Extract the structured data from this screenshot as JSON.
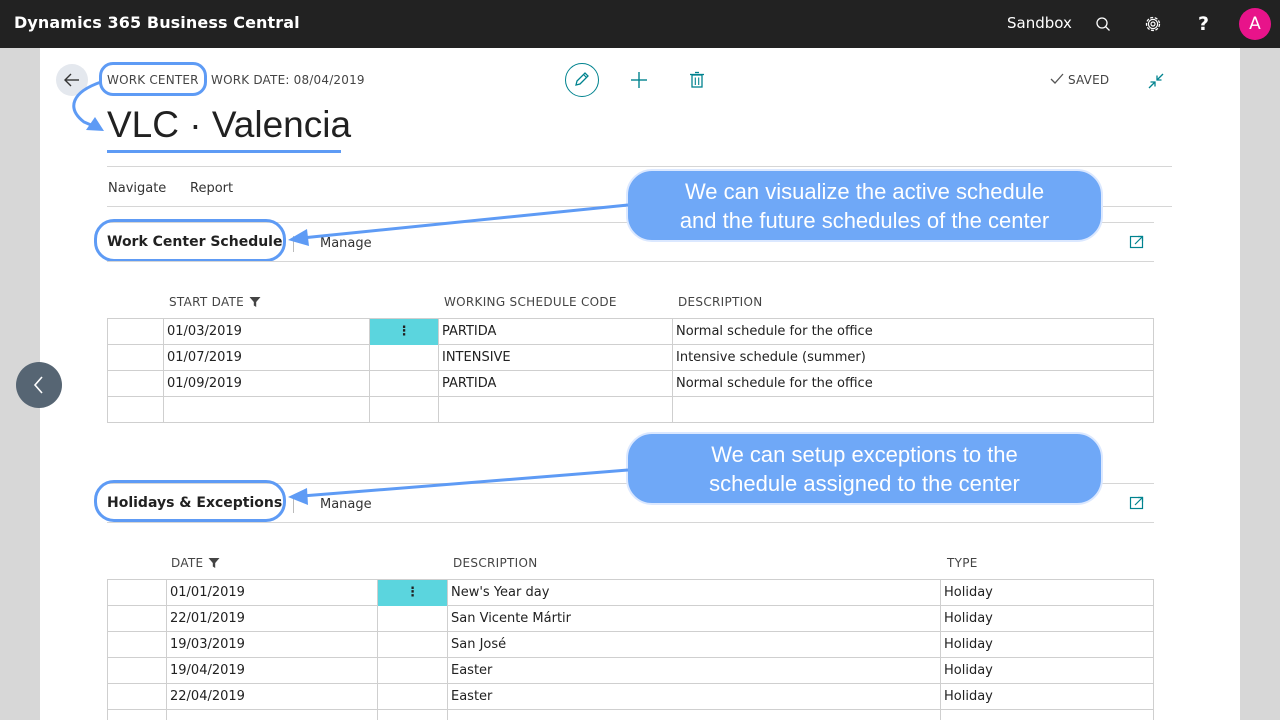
{
  "topbar": {
    "app_title": "Dynamics 365 Business Central",
    "environment": "Sandbox",
    "help_label": "?",
    "avatar_initial": "A",
    "icons": [
      "search-icon",
      "gear-icon"
    ]
  },
  "header": {
    "breadcrumb": "WORK CENTER",
    "work_date": "WORK DATE: 08/04/2019",
    "saved_label": "SAVED",
    "page_title": "VLC · Valencia",
    "actions": [
      "pencil-icon",
      "plus-icon",
      "trash-icon"
    ]
  },
  "menu": {
    "items": [
      "Navigate",
      "Report"
    ]
  },
  "schedule": {
    "title": "Work Center Schedule",
    "manage_label": "Manage",
    "columns": [
      "START DATE",
      "WORKING SCHEDULE CODE",
      "DESCRIPTION"
    ],
    "rows": [
      {
        "start_date": "01/03/2019",
        "code": "PARTIDA",
        "description": "Normal schedule for the office"
      },
      {
        "start_date": "01/07/2019",
        "code": "INTENSIVE",
        "description": "Intensive schedule (summer)"
      },
      {
        "start_date": "01/09/2019",
        "code": "PARTIDA",
        "description": "Normal schedule for the office"
      }
    ]
  },
  "holidays": {
    "title": "Holidays & Exceptions",
    "manage_label": "Manage",
    "columns": [
      "DATE",
      "DESCRIPTION",
      "TYPE"
    ],
    "rows": [
      {
        "date": "01/01/2019",
        "description": "New's Year day",
        "type": "Holiday"
      },
      {
        "date": "22/01/2019",
        "description": "San Vicente Mártir",
        "type": "Holiday"
      },
      {
        "date": "19/03/2019",
        "description": "San José",
        "type": "Holiday"
      },
      {
        "date": "19/04/2019",
        "description": "Easter",
        "type": "Holiday"
      },
      {
        "date": "22/04/2019",
        "description": "Easter",
        "type": "Holiday"
      }
    ]
  },
  "row_menu_glyph": "⋮",
  "callouts": {
    "schedule": [
      "We can visualize the active schedule",
      "and the future schedules of the center"
    ],
    "exceptions": [
      "We can setup exceptions to the",
      "schedule assigned to the center"
    ]
  },
  "colors": {
    "topbar": "#222222",
    "avatar": "#e8138a",
    "accent_teal": "#00838f",
    "row_highlight": "#5bd5de",
    "annotation_blue": "#5e9bf5",
    "callout_fill": "#6fa8f7"
  }
}
